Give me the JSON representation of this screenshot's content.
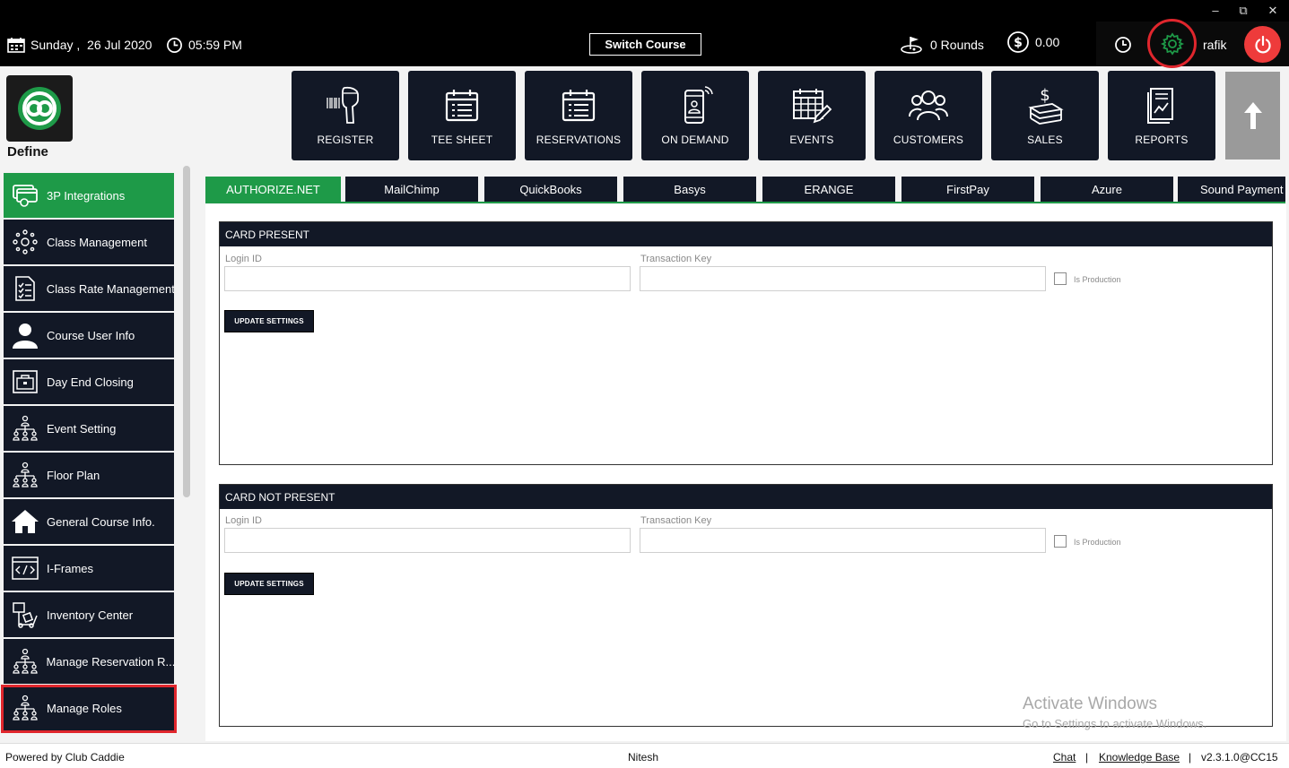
{
  "header": {
    "date": "Sunday ,  26 Jul 2020",
    "time": "05:59 PM",
    "switch_course": "Switch Course",
    "rounds": "0 Rounds",
    "amount": "0.00",
    "user": "rafik"
  },
  "window_controls": {
    "minimize": "–",
    "restore": "⧉",
    "close": "✕"
  },
  "logo": {
    "label": "Define",
    "accent": "#1e9a48"
  },
  "tiles": [
    {
      "label": "REGISTER",
      "icon": "barcode-scanner-icon"
    },
    {
      "label": "TEE SHEET",
      "icon": "calendar-list-icon"
    },
    {
      "label": "RESERVATIONS",
      "icon": "calendar-list-icon"
    },
    {
      "label": "ON DEMAND",
      "icon": "mobile-phone-icon"
    },
    {
      "label": "EVENTS",
      "icon": "calendar-edit-icon"
    },
    {
      "label": "CUSTOMERS",
      "icon": "users-icon"
    },
    {
      "label": "SALES",
      "icon": "money-stack-icon"
    },
    {
      "label": "REPORTS",
      "icon": "report-chart-icon"
    }
  ],
  "sidebar": {
    "items": [
      {
        "label": "3P Integrations",
        "icon": "integrations-icon",
        "active": true
      },
      {
        "label": "Class Management",
        "icon": "class-management-icon"
      },
      {
        "label": "Class Rate Management",
        "icon": "checklist-icon"
      },
      {
        "label": "Course User Info",
        "icon": "user-icon"
      },
      {
        "label": "Day End Closing",
        "icon": "briefcase-icon"
      },
      {
        "label": "Event Setting",
        "icon": "hierarchy-icon"
      },
      {
        "label": "Floor Plan",
        "icon": "hierarchy-icon"
      },
      {
        "label": "General Course Info.",
        "icon": "home-icon"
      },
      {
        "label": "I-Frames",
        "icon": "code-icon"
      },
      {
        "label": "Inventory Center",
        "icon": "inventory-icon"
      },
      {
        "label": "Manage Reservation R...",
        "icon": "hierarchy-icon"
      },
      {
        "label": "Manage Roles",
        "icon": "hierarchy-icon"
      }
    ]
  },
  "tabs": [
    "AUTHORIZE.NET",
    "MailChimp",
    "QuickBooks",
    "Basys",
    "ERANGE",
    "FirstPay",
    "Azure",
    "Sound Payment"
  ],
  "card_present": {
    "title": "CARD PRESENT",
    "login_label": "Login ID",
    "login_value": "",
    "key_label": "Transaction Key",
    "key_value": "",
    "production_label": "Is Production",
    "button": "UPDATE SETTINGS"
  },
  "card_not_present": {
    "title": "CARD NOT PRESENT",
    "login_label": "Login ID",
    "login_value": "",
    "key_label": "Transaction Key",
    "key_value": "",
    "production_label": "Is Production",
    "button": "UPDATE SETTINGS"
  },
  "watermark": {
    "line1": "Activate Windows",
    "line2": "Go to Settings to activate Windows."
  },
  "footer": {
    "powered": "Powered by Club Caddie",
    "center": "Nitesh",
    "chat": "Chat",
    "sep1": "|",
    "knowledge": "Knowledge Base",
    "sep2": "|",
    "version": "v2.3.1.0@CC15"
  },
  "colors": {
    "navy": "#121826",
    "green": "#1e9a48",
    "red": "#e0262d"
  }
}
